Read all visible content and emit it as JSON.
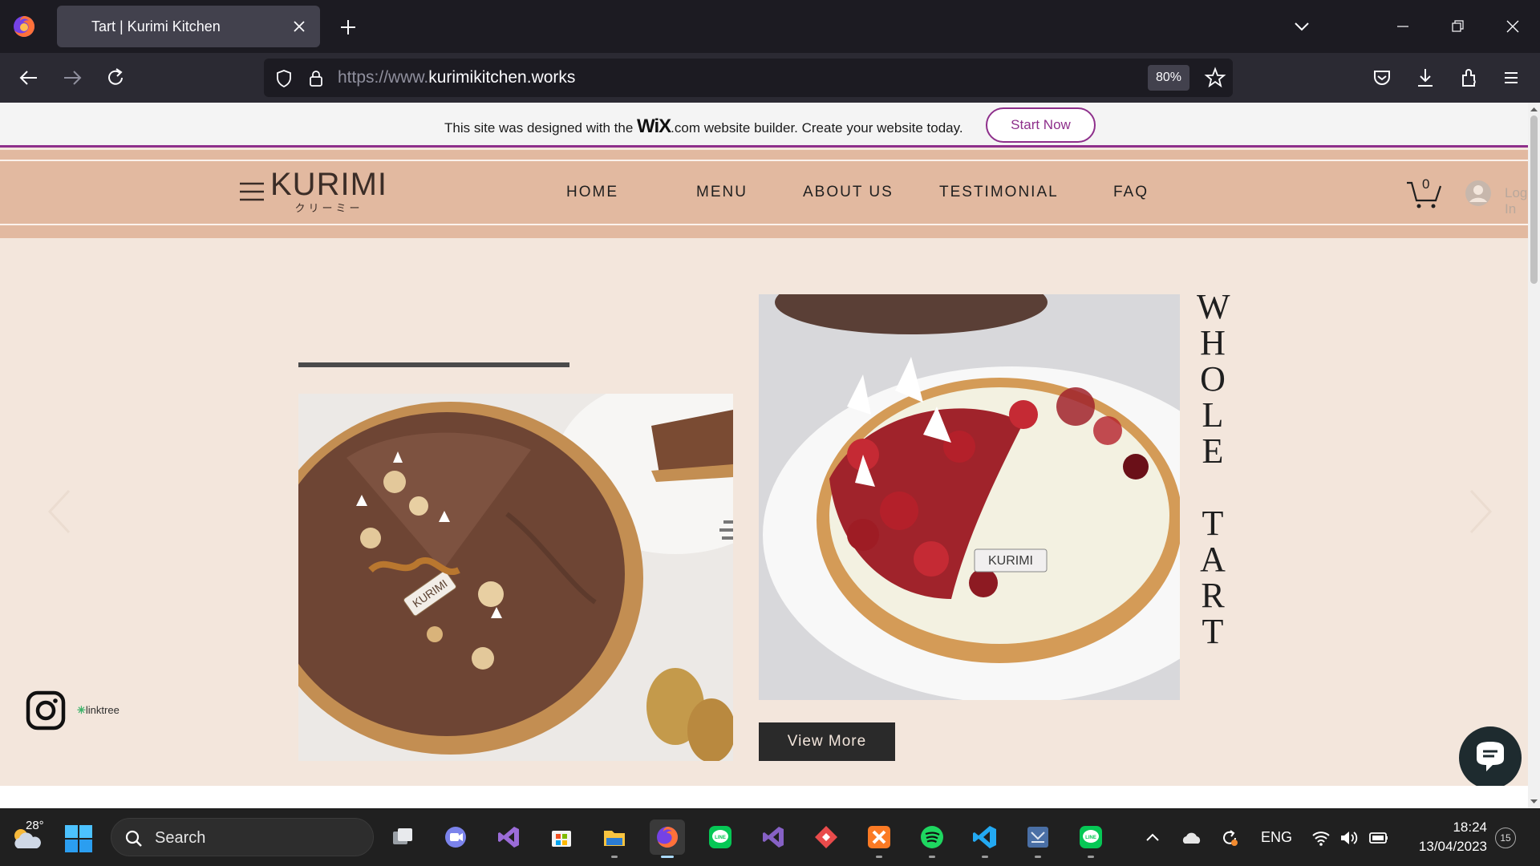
{
  "browser": {
    "tab_title": "Tart | Kurimi Kitchen",
    "url_prefix": "https://www.",
    "url_domain": "kurimikitchen.works",
    "zoom": "80%"
  },
  "wix_banner": {
    "text_before": "This site was designed with the ",
    "logo": "WiX",
    "text_after": ".com website builder. Create your website today.",
    "cta": "Start Now"
  },
  "site": {
    "logo": "KURIMI",
    "logo_sub": "クリーミー",
    "menu": [
      "HOME",
      "MENU",
      "ABOUT US",
      "TESTIMONIAL",
      "FAQ"
    ],
    "cart_count": "0",
    "login_label": "Log In"
  },
  "slide": {
    "title_letters": [
      "W",
      "H",
      "O",
      "L",
      "E",
      "",
      "T",
      "A",
      "R",
      "T"
    ],
    "view_more": "View More",
    "plaque_text": "KURIMI"
  },
  "social": {
    "linktree": "linktree"
  },
  "taskbar": {
    "temp": "28°",
    "search_placeholder": "Search",
    "lang": "ENG",
    "time": "18:24",
    "date": "13/04/2023",
    "notifications": "15"
  },
  "colors": {
    "page_bg": "#f3e6dc",
    "header_bg": "#e2b9a0",
    "wix_accent": "#8e2f8b"
  }
}
